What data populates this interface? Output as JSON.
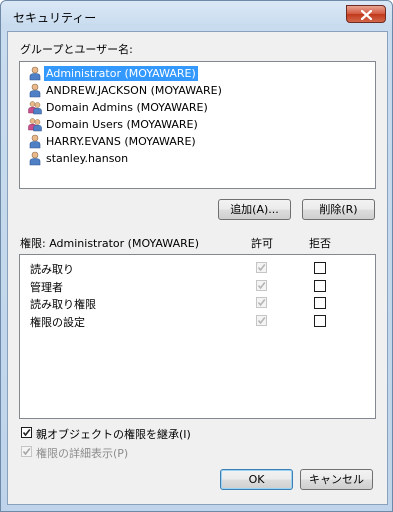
{
  "window": {
    "title": "セキュリティー"
  },
  "groups": {
    "label": "グループとユーザー名:",
    "items": [
      {
        "name": "Administrator (MOYAWARE)",
        "icon": "user-icon",
        "selected": true
      },
      {
        "name": "ANDREW.JACKSON (MOYAWARE)",
        "icon": "user-icon",
        "selected": false
      },
      {
        "name": "Domain Admins (MOYAWARE)",
        "icon": "group-icon",
        "selected": false
      },
      {
        "name": "Domain Users (MOYAWARE)",
        "icon": "group-icon",
        "selected": false
      },
      {
        "name": "HARRY.EVANS (MOYAWARE)",
        "icon": "user-icon",
        "selected": false
      },
      {
        "name": "stanley.hanson",
        "icon": "user-icon",
        "selected": false
      }
    ]
  },
  "buttons": {
    "add": "追加(A)...",
    "remove": "削除(R)",
    "ok": "OK",
    "cancel": "キャンセル"
  },
  "permissions": {
    "header": "権限: Administrator (MOYAWARE)",
    "allow_label": "許可",
    "deny_label": "拒否",
    "rows": [
      {
        "name": "読み取り",
        "allow": true,
        "deny": false
      },
      {
        "name": "管理者",
        "allow": true,
        "deny": false
      },
      {
        "name": "読み取り権限",
        "allow": true,
        "deny": false
      },
      {
        "name": "権限の設定",
        "allow": true,
        "deny": false
      }
    ]
  },
  "options": {
    "inherit": "親オブジェクトの権限を継承(I)",
    "inherit_checked": true,
    "details": "権限の詳細表示(P)",
    "details_checked": true,
    "details_enabled": false
  },
  "colors": {
    "selection": "#3399ff",
    "window_frame": "#bfd4ea",
    "close_button": "#c0381b"
  }
}
